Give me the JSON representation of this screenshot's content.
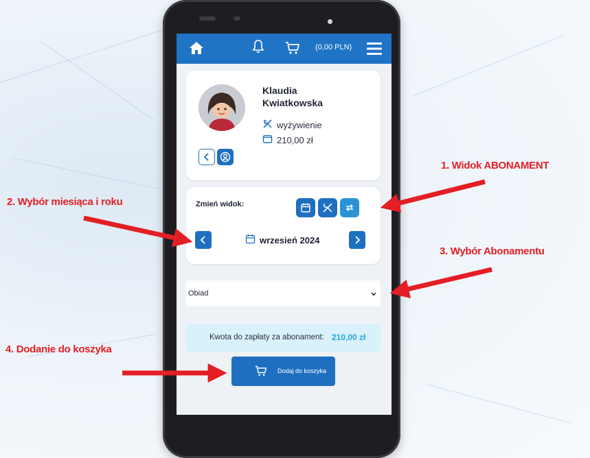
{
  "topbar": {
    "cart_total": "(0,00 PLN)",
    "icons": [
      "home-icon",
      "bell-icon",
      "cart-icon",
      "hamburger-menu-icon"
    ]
  },
  "profile": {
    "name_line1": "Klaudia",
    "name_line2": "Kwiatkowska",
    "service": "wyżywienie",
    "balance": "210,00 zł"
  },
  "view": {
    "label": "Zmień widok:",
    "month": "wrzesień 2024"
  },
  "subscription": {
    "selected": "Obiad"
  },
  "payment": {
    "label": "Kwota do zapłaty za abonament:",
    "amount": "210,00 zł"
  },
  "add_to_cart": {
    "label": "Dodaj do koszyka"
  },
  "annotations": {
    "a1": "1. Widok ABONAMENT",
    "a2": "2. Wybór miesiąca i roku",
    "a3": "3. Wybór Abonamentu",
    "a4": "4. Dodanie do koszyka"
  },
  "colors": {
    "primary": "#1f6fc0",
    "topbar": "#1f74c6",
    "accent_light": "#2a93d8",
    "amount": "#25a8dc",
    "payment_bg": "#d8f1fb",
    "annotation_red": "#e31e24"
  }
}
